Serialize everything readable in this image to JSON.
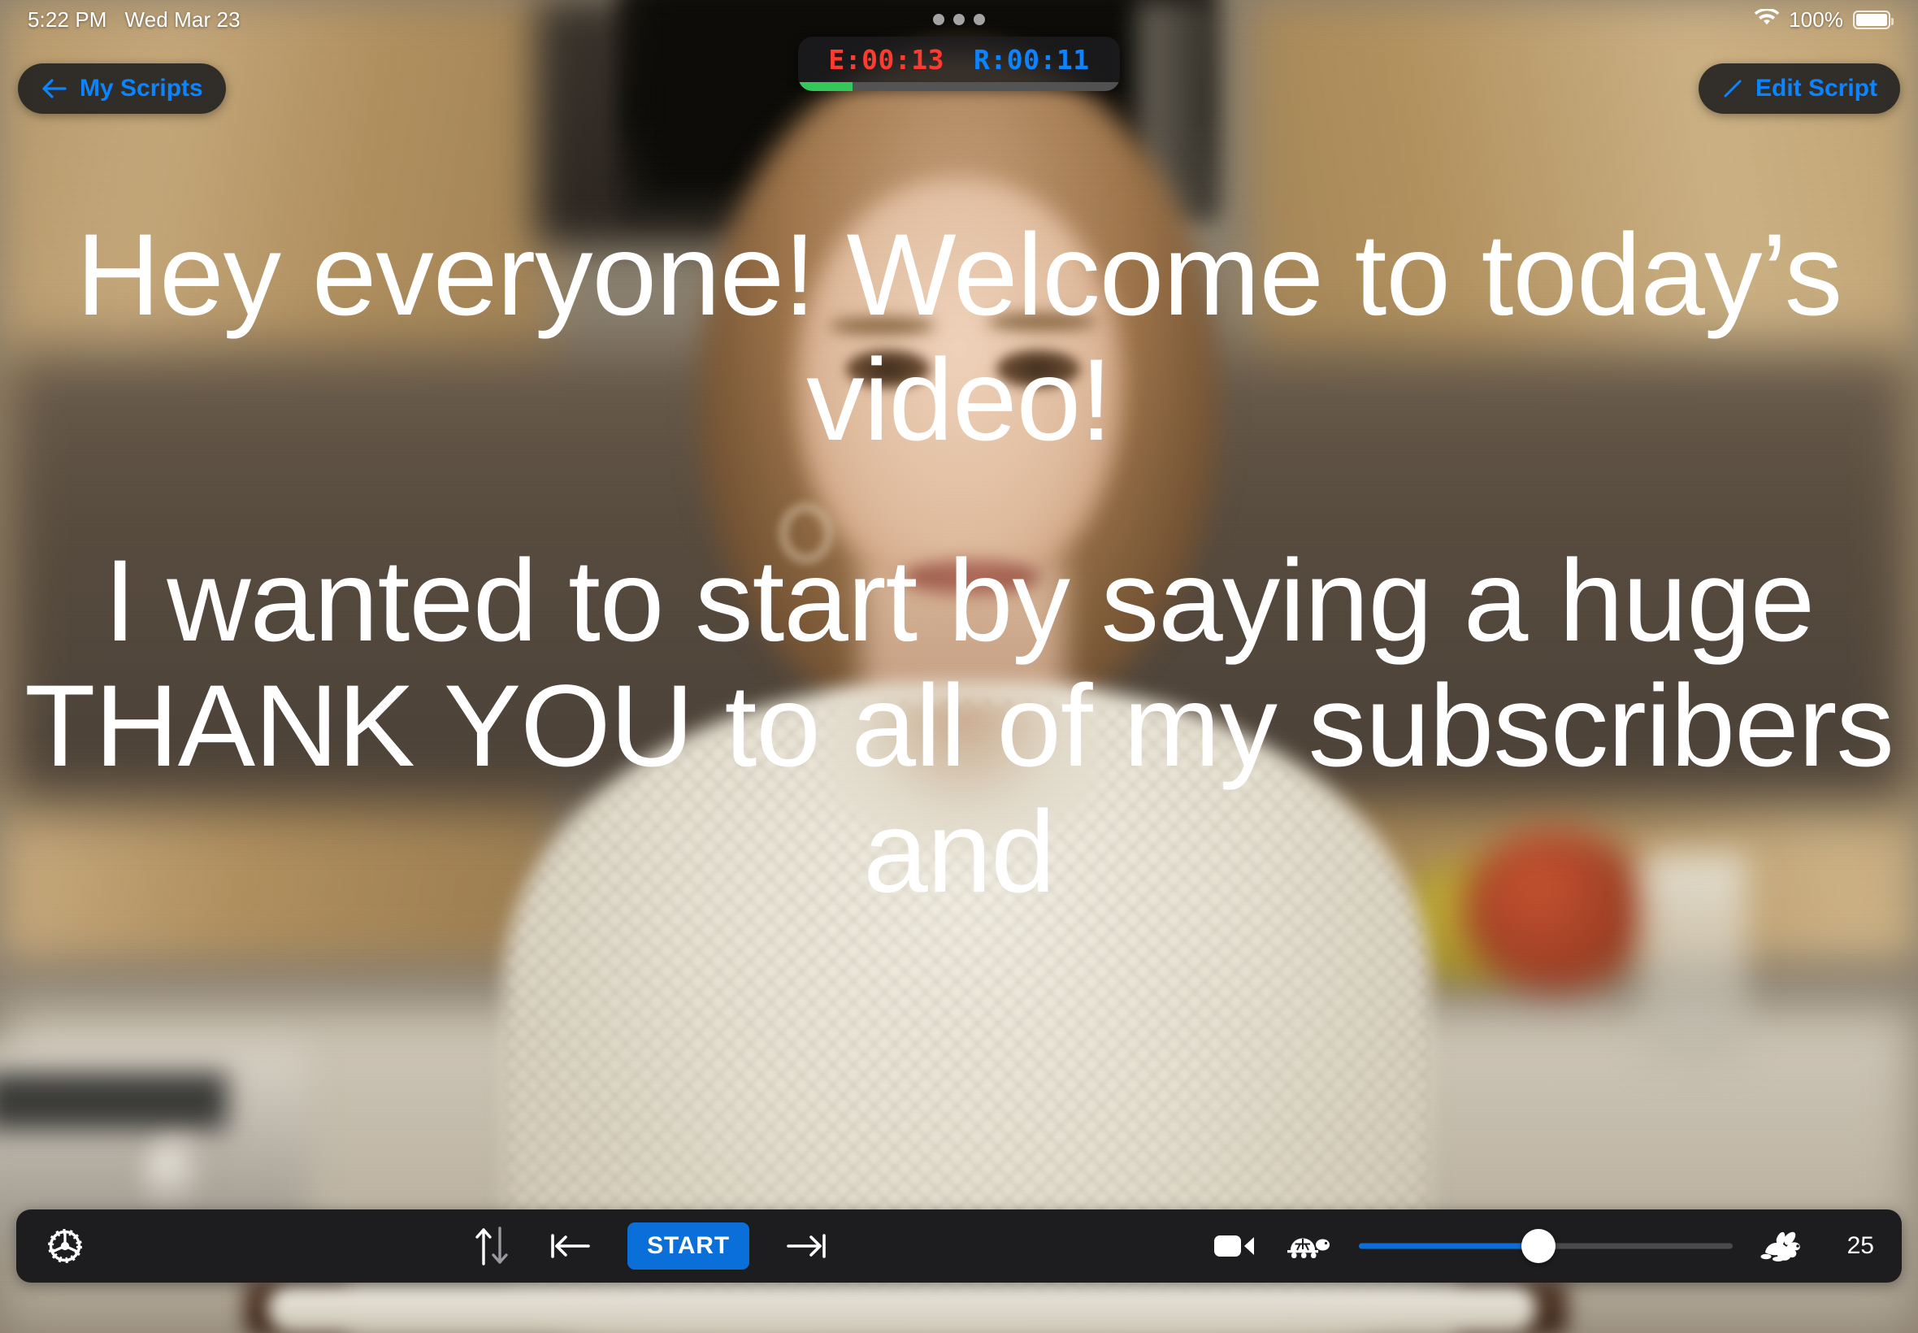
{
  "status_bar": {
    "time": "5:22 PM",
    "date": "Wed Mar 23",
    "battery_percent": "100%",
    "wifi_icon": "wifi-icon",
    "battery_icon": "battery-full-icon"
  },
  "nav": {
    "back_label": "My Scripts",
    "back_icon": "arrow-left-icon",
    "edit_label": "Edit Script",
    "edit_icon": "pencil-icon"
  },
  "timer": {
    "elapsed": "E:00:13",
    "remaining": "R:00:11",
    "elapsed_color": "#ff3b30",
    "remaining_color": "#0a84ff",
    "progress_color": "#34c759",
    "progress_percent": 17,
    "grabber_icon": "grabber-dots-icon"
  },
  "script": {
    "paragraphs": [
      "Hey everyone! Welcome to today’s video!",
      "I wanted to start by saying a huge THANK YOU to all of my subscribers and"
    ]
  },
  "toolbar": {
    "settings_icon": "gear-icon",
    "flip_icon": "flip-vertical-arrows-icon",
    "skip_start_icon": "skip-to-start-icon",
    "start_label": "START",
    "start_color": "#0a6fd8",
    "skip_end_icon": "skip-to-end-icon",
    "camera_icon": "video-camera-icon",
    "slow_icon": "turtle-icon",
    "fast_icon": "rabbit-icon",
    "speed_value": "25",
    "speed_slider_percent": 48
  }
}
